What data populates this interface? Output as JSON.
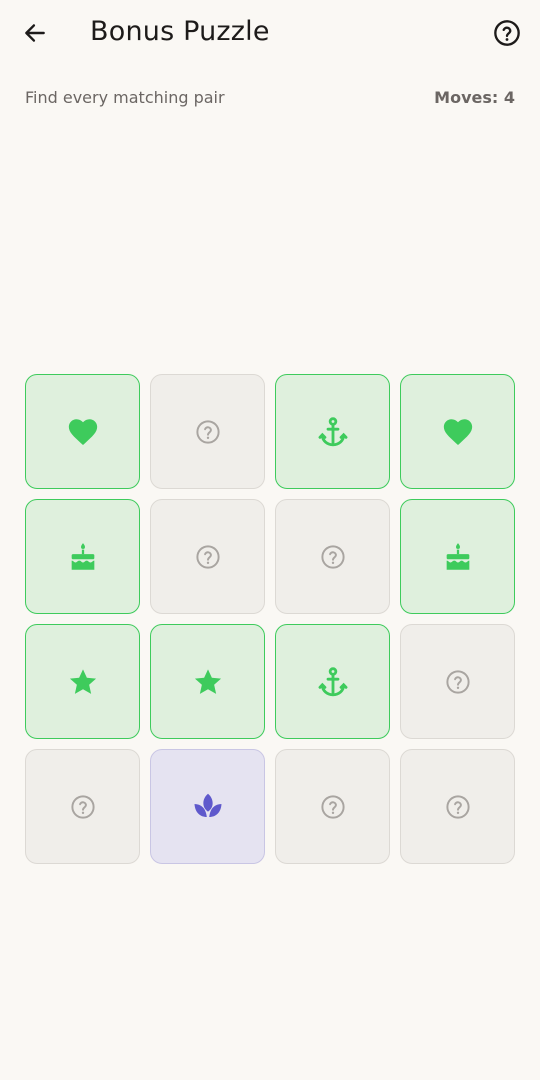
{
  "header": {
    "title": "Bonus Puzzle",
    "back_icon": "arrow-left-icon",
    "help_icon": "help-circle-icon"
  },
  "status": {
    "instructions": "Find every matching pair",
    "moves_label": "Moves: 4"
  },
  "colors": {
    "matched": "#3ecb5c",
    "flipped": "#5f59cc",
    "hidden_icon": "#a9a5a1"
  },
  "board": {
    "rows": 4,
    "cols": 4,
    "tiles": [
      {
        "state": "matched",
        "icon": "heart-icon"
      },
      {
        "state": "hidden",
        "icon": "question-icon"
      },
      {
        "state": "matched",
        "icon": "anchor-icon"
      },
      {
        "state": "matched",
        "icon": "heart-icon"
      },
      {
        "state": "matched",
        "icon": "cake-icon"
      },
      {
        "state": "hidden",
        "icon": "question-icon"
      },
      {
        "state": "hidden",
        "icon": "question-icon"
      },
      {
        "state": "matched",
        "icon": "cake-icon"
      },
      {
        "state": "matched",
        "icon": "star-icon"
      },
      {
        "state": "matched",
        "icon": "star-icon"
      },
      {
        "state": "matched",
        "icon": "anchor-icon"
      },
      {
        "state": "hidden",
        "icon": "question-icon"
      },
      {
        "state": "hidden",
        "icon": "question-icon"
      },
      {
        "state": "flipped",
        "icon": "lotus-icon"
      },
      {
        "state": "hidden",
        "icon": "question-icon"
      },
      {
        "state": "hidden",
        "icon": "question-icon"
      }
    ]
  }
}
